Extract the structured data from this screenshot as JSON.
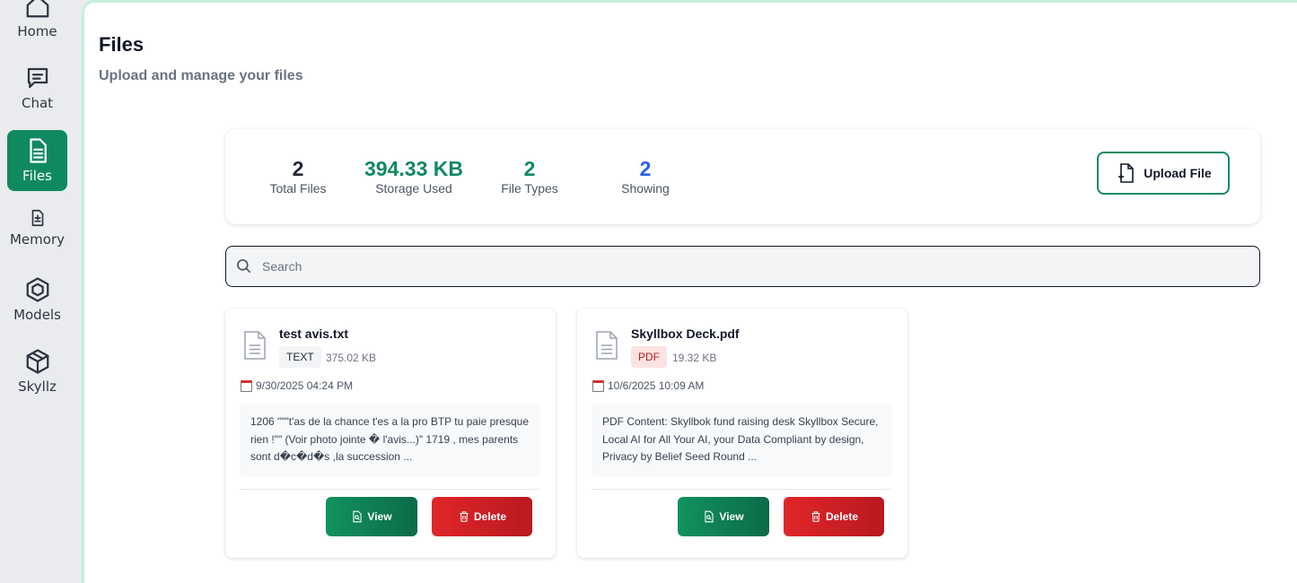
{
  "sidebar": {
    "items": [
      {
        "label": "Home",
        "icon": "home-icon"
      },
      {
        "label": "Chat",
        "icon": "chat-icon"
      },
      {
        "label": "Files",
        "icon": "file-icon",
        "active": true
      },
      {
        "label": "Memory",
        "icon": "memory-icon"
      },
      {
        "label": "Models",
        "icon": "models-icon"
      },
      {
        "label": "Skyllz",
        "icon": "box-icon"
      }
    ]
  },
  "page": {
    "title": "Files",
    "subtitle": "Upload and manage your files"
  },
  "stats": [
    {
      "value": "2",
      "caption": "Total Files",
      "color": "#111827"
    },
    {
      "value": "394.33 KB",
      "caption": "Storage Used",
      "color": "#0f8a5f"
    },
    {
      "value": "2",
      "caption": "File Types",
      "color": "#0f8a5f"
    },
    {
      "value": "2",
      "caption": "Showing",
      "color": "#2563eb"
    }
  ],
  "upload_button": {
    "label": "Upload File"
  },
  "search": {
    "placeholder": "Search",
    "value": ""
  },
  "files": [
    {
      "name": "test avis.txt",
      "type": "TEXT",
      "size": "375.02 KB",
      "date": "9/30/2025 04:24 PM",
      "preview": "1206 \"\"\"t'as de la chance t'es a la pro BTP tu paie presque rien !\"\" (Voir photo jointe � l'avis...)\" 1719 , mes parents sont d�c�d�s ,la succession ...",
      "view_label": "View",
      "delete_label": "Delete"
    },
    {
      "name": "Skyllbox Deck.pdf",
      "type": "PDF",
      "size": "19.32 KB",
      "date": "10/6/2025 10:09 AM",
      "preview": "PDF Content: Skyllbok fund raising desk Skyllbox Secure, Local AI for All Your AI, your Data Compliant by design, Privacy by Belief Seed Round ...",
      "view_label": "View",
      "delete_label": "Delete"
    }
  ],
  "colors": {
    "accent": "#0f8a5f",
    "danger": "#dc2626",
    "info": "#2563eb"
  }
}
